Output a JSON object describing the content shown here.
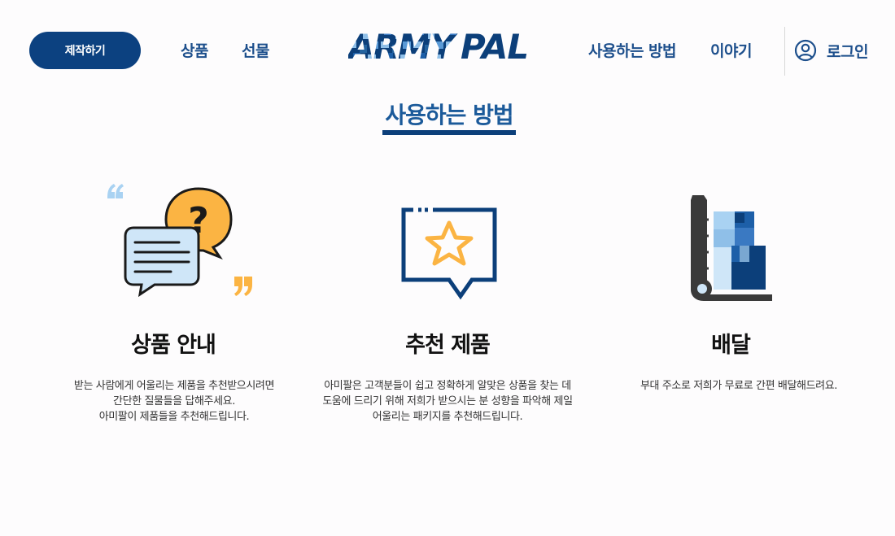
{
  "header": {
    "make_button": "제작하기",
    "nav_left": [
      "상품",
      "선물"
    ],
    "logo_text": "ARMYPAL",
    "nav_right": [
      "사용하는 방법",
      "이야기"
    ],
    "login_label": "로그인"
  },
  "section": {
    "title": "사용하는 방법"
  },
  "steps": [
    {
      "icon": "chat-question-icon",
      "title": "상품 안내",
      "desc": [
        "받는 사람에게 어울리는 제품을 추천받으시려면",
        "간단한 질물들을 답해주세요.",
        "아미팔이 제품들을 추천해드립니다."
      ]
    },
    {
      "icon": "star-message-icon",
      "title": "추천 제품",
      "desc": [
        "아미팔은 고객분들이 쉽고 정확하게 알맞은 상품을 찾는 데",
        "도움에 드리기 위해 저희가 받으시는 분 성향을 파악해 제일",
        "어울리는 패키지를 추천해드립니다."
      ]
    },
    {
      "icon": "hand-truck-delivery-icon",
      "title": "배달",
      "desc": [
        "부대 주소로 저희가 무료로 간편 배달해드려요."
      ]
    }
  ],
  "colors": {
    "primary": "#0c4180",
    "nav_text": "#1d4f8c",
    "accent_orange": "#fbb443",
    "light_blue": "#cfe6f8"
  }
}
